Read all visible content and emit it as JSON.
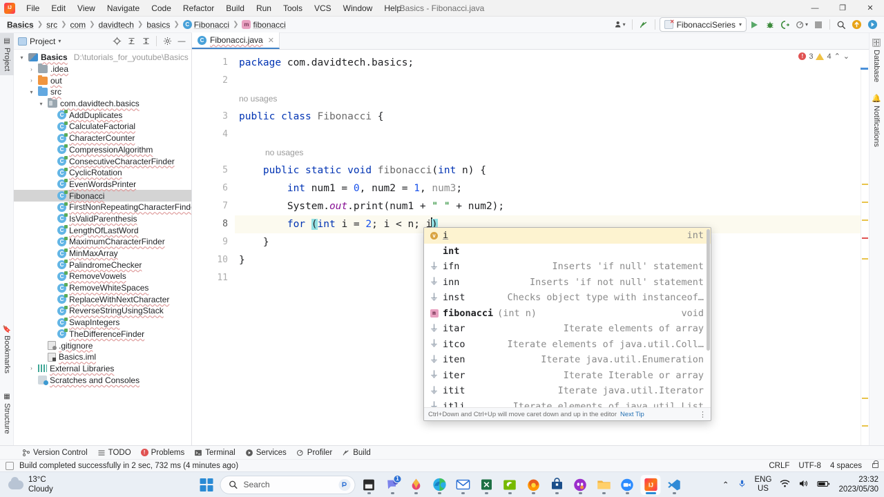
{
  "window": {
    "title": "Basics - Fibonacci.java",
    "app_icon": "intellij-idea-logo",
    "minimize": "—",
    "maximize": "❐",
    "close": "✕"
  },
  "menu": {
    "items": [
      {
        "label": "File"
      },
      {
        "label": "Edit"
      },
      {
        "label": "View"
      },
      {
        "label": "Navigate"
      },
      {
        "label": "Code"
      },
      {
        "label": "Refactor"
      },
      {
        "label": "Build"
      },
      {
        "label": "Run"
      },
      {
        "label": "Tools"
      },
      {
        "label": "VCS"
      },
      {
        "label": "Window"
      },
      {
        "label": "Help"
      }
    ]
  },
  "breadcrumbs": {
    "items": [
      {
        "label": "Basics",
        "icon": "none",
        "bold": true
      },
      {
        "label": "src",
        "icon": "none",
        "bold": false
      },
      {
        "label": "com",
        "icon": "none",
        "bold": false
      },
      {
        "label": "davidtech",
        "icon": "none",
        "bold": false
      },
      {
        "label": "basics",
        "icon": "none",
        "bold": false
      },
      {
        "label": "Fibonacci",
        "icon": "java-class-icon",
        "bold": false
      },
      {
        "label": "fibonacci",
        "icon": "java-method-icon",
        "bold": false
      }
    ]
  },
  "toolbar": {
    "user_icon": "account-icon",
    "back_icon": "updates-arrow-icon",
    "run_config": "FibonacciSeries",
    "run_icon": "run-icon",
    "debug_icon": "debug-icon",
    "run_with_coverage_icon": "coverage-icon",
    "profile_icon": "profiler-icon",
    "stop_icon": "stop-icon",
    "search_icon": "search-everywhere-icon",
    "update_icon": "update-project-icon",
    "next_icon": "forward-icon"
  },
  "left_strip": {
    "tools": [
      {
        "label": "Project",
        "icon": "project-icon",
        "active": true
      },
      {
        "label": "Bookmarks",
        "icon": "bookmarks-icon",
        "active": false
      },
      {
        "label": "Structure",
        "icon": "structure-icon",
        "active": false
      }
    ]
  },
  "right_strip": {
    "tools": [
      {
        "label": "Database",
        "icon": "database-icon"
      },
      {
        "label": "Notifications",
        "icon": "notifications-icon"
      }
    ]
  },
  "project_panel": {
    "title": "Project",
    "actions": [
      "locate-icon",
      "expand-all-icon",
      "collapse-all-icon",
      "settings-gear-icon",
      "hide-icon"
    ],
    "tree": [
      {
        "label": "Basics",
        "path": "D:\\tutorials_for_youtube\\Basics",
        "icon": "project-folder-icon",
        "indent": 0,
        "arrow": "▾",
        "bold": true,
        "selected": false
      },
      {
        "label": ".idea",
        "icon": "folder-icon",
        "indent": 1,
        "arrow": "›",
        "selected": false
      },
      {
        "label": "out",
        "icon": "folder-orange-icon",
        "indent": 1,
        "arrow": "›",
        "selected": false
      },
      {
        "label": "src",
        "icon": "folder-blue-icon",
        "indent": 1,
        "arrow": "▾",
        "selected": false
      },
      {
        "label": "com.davidtech.basics",
        "icon": "package-icon",
        "indent": 2,
        "arrow": "▾",
        "selected": false
      },
      {
        "label": "AddDuplicates",
        "icon": "java-class-icon",
        "indent": 3,
        "arrow": "",
        "selected": false
      },
      {
        "label": "CalculateFactorial",
        "icon": "java-class-icon",
        "indent": 3,
        "arrow": "",
        "selected": false
      },
      {
        "label": "CharacterCounter",
        "icon": "java-class-icon",
        "indent": 3,
        "arrow": "",
        "selected": false
      },
      {
        "label": "CompressionAlgorithm",
        "icon": "java-class-icon",
        "indent": 3,
        "arrow": "",
        "selected": false
      },
      {
        "label": "ConsecutiveCharacterFinder",
        "icon": "java-class-icon",
        "indent": 3,
        "arrow": "",
        "selected": false
      },
      {
        "label": "CyclicRotation",
        "icon": "java-class-icon",
        "indent": 3,
        "arrow": "",
        "selected": false
      },
      {
        "label": "EvenWordsPrinter",
        "icon": "java-class-icon",
        "indent": 3,
        "arrow": "",
        "selected": false
      },
      {
        "label": "Fibonacci",
        "icon": "java-class-icon",
        "indent": 3,
        "arrow": "",
        "selected": true
      },
      {
        "label": "FirstNonRepeatingCharacterFinder",
        "icon": "java-class-icon",
        "indent": 3,
        "arrow": "",
        "selected": false
      },
      {
        "label": "IsValidParenthesis",
        "icon": "java-class-icon",
        "indent": 3,
        "arrow": "",
        "selected": false
      },
      {
        "label": "LengthOfLastWord",
        "icon": "java-class-icon",
        "indent": 3,
        "arrow": "",
        "selected": false
      },
      {
        "label": "MaximumCharacterFinder",
        "icon": "java-class-icon",
        "indent": 3,
        "arrow": "",
        "selected": false
      },
      {
        "label": "MinMaxArray",
        "icon": "java-class-icon",
        "indent": 3,
        "arrow": "",
        "selected": false
      },
      {
        "label": "PalindromeChecker",
        "icon": "java-class-icon",
        "indent": 3,
        "arrow": "",
        "selected": false
      },
      {
        "label": "RemoveVowels",
        "icon": "java-class-icon",
        "indent": 3,
        "arrow": "",
        "selected": false
      },
      {
        "label": "RemoveWhiteSpaces",
        "icon": "java-class-icon",
        "indent": 3,
        "arrow": "",
        "selected": false
      },
      {
        "label": "ReplaceWithNextCharacter",
        "icon": "java-class-icon",
        "indent": 3,
        "arrow": "",
        "selected": false
      },
      {
        "label": "ReverseStringUsingStack",
        "icon": "java-class-icon",
        "indent": 3,
        "arrow": "",
        "selected": false
      },
      {
        "label": "SwapIntegers",
        "icon": "java-class-icon",
        "indent": 3,
        "arrow": "",
        "selected": false
      },
      {
        "label": "TheDifferenceFinder",
        "icon": "java-class-icon",
        "indent": 3,
        "arrow": "",
        "selected": false
      },
      {
        "label": ".gitignore",
        "icon": "gitignore-file-icon",
        "indent": 2,
        "arrow": "",
        "selected": false
      },
      {
        "label": "Basics.iml",
        "icon": "iml-file-icon",
        "indent": 2,
        "arrow": "",
        "selected": false
      },
      {
        "label": "External Libraries",
        "icon": "libraries-icon",
        "indent": 1,
        "arrow": "›",
        "selected": false
      },
      {
        "label": "Scratches and Consoles",
        "icon": "scratches-icon",
        "indent": 1,
        "arrow": "",
        "selected": false
      }
    ]
  },
  "editor": {
    "tab": {
      "label": "Fibonacci.java",
      "icon": "java-class-icon",
      "close": "✕"
    },
    "inspections": {
      "errors": "3",
      "warnings": "4",
      "prev": "⌃",
      "next": "⌄"
    },
    "lines": [
      {
        "num": "1",
        "text": "package com.davidtech.basics;"
      },
      {
        "num": "2",
        "text": ""
      },
      {
        "num": "",
        "text": "no usages",
        "inlay": true
      },
      {
        "num": "3",
        "text": "public class Fibonacci {"
      },
      {
        "num": "4",
        "text": ""
      },
      {
        "num": "",
        "text": "no usages",
        "inlay": true
      },
      {
        "num": "5",
        "text": "    public static void fibonacci(int n) {"
      },
      {
        "num": "6",
        "text": "        int num1 = 0, num2 = 1, num3;"
      },
      {
        "num": "7",
        "text": "        System.out.print(num1 + \" \" + num2);"
      },
      {
        "num": "8",
        "text": "        for (int i = 2; i < n; i)",
        "current": true
      },
      {
        "num": "9",
        "text": "    }"
      },
      {
        "num": "10",
        "text": "}"
      },
      {
        "num": "11",
        "text": ""
      }
    ]
  },
  "autocomplete": {
    "items": [
      {
        "icon": "variable-icon",
        "name": "i",
        "args": "",
        "desc": "",
        "type": "int",
        "selected": true
      },
      {
        "icon": "none",
        "name": "int",
        "args": "",
        "desc": "",
        "type": "",
        "selected": false
      },
      {
        "icon": "live-template-icon",
        "name": "ifn",
        "args": "",
        "desc": "Inserts 'if null' statement",
        "type": "",
        "selected": false
      },
      {
        "icon": "live-template-icon",
        "name": "inn",
        "args": "",
        "desc": "Inserts 'if not null' statement",
        "type": "",
        "selected": false
      },
      {
        "icon": "live-template-icon",
        "name": "inst",
        "args": "",
        "desc": "Checks object type with instanceof…",
        "type": "",
        "selected": false
      },
      {
        "icon": "method-icon",
        "name": "fibonacci",
        "args": "(int n)",
        "desc": "",
        "type": "void",
        "selected": false
      },
      {
        "icon": "live-template-icon",
        "name": "itar",
        "args": "",
        "desc": "Iterate elements of array",
        "type": "",
        "selected": false
      },
      {
        "icon": "live-template-icon",
        "name": "itco",
        "args": "",
        "desc": "Iterate elements of java.util.Coll…",
        "type": "",
        "selected": false
      },
      {
        "icon": "live-template-icon",
        "name": "iten",
        "args": "",
        "desc": "Iterate java.util.Enumeration",
        "type": "",
        "selected": false
      },
      {
        "icon": "live-template-icon",
        "name": "iter",
        "args": "",
        "desc": "Iterate Iterable or array",
        "type": "",
        "selected": false
      },
      {
        "icon": "live-template-icon",
        "name": "itit",
        "args": "",
        "desc": "Iterate java.util.Iterator",
        "type": "",
        "selected": false
      },
      {
        "icon": "live-template-icon",
        "name": "itli",
        "args": "",
        "desc": "Iterate elements of java.util.List",
        "type": "",
        "selected": false
      }
    ],
    "footer_hint": "Ctrl+Down and Ctrl+Up will move caret down and up in the editor",
    "footer_link": "Next Tip",
    "footer_menu": "⋮"
  },
  "tool_window_bar": {
    "items": [
      {
        "label": "Version Control",
        "icon": "version-control-icon"
      },
      {
        "label": "TODO",
        "icon": "todo-icon"
      },
      {
        "label": "Problems",
        "icon": "problems-icon"
      },
      {
        "label": "Terminal",
        "icon": "terminal-icon"
      },
      {
        "label": "Services",
        "icon": "services-icon"
      },
      {
        "label": "Profiler",
        "icon": "profiler-icon"
      },
      {
        "label": "Build",
        "icon": "build-icon"
      }
    ]
  },
  "status_bar": {
    "message": "Build completed successfully in 2 sec, 732 ms (4 minutes ago)",
    "line_separator": "CRLF",
    "encoding": "UTF-8",
    "indent": "4 spaces",
    "lock_icon": "read-only-lock-icon"
  },
  "taskbar": {
    "weather": {
      "temp": "13°C",
      "condition": "Cloudy",
      "icon": "cloud-icon"
    },
    "start_icon": "windows-start-icon",
    "search": {
      "placeholder": "Search",
      "icon": "search-icon",
      "copilot_icon": "copilot-icon"
    },
    "apps": [
      {
        "name": "file-manager-icon",
        "badge": "",
        "active": false
      },
      {
        "name": "teams-icon",
        "badge": "1",
        "active": false
      },
      {
        "name": "water-drop-icon",
        "badge": "",
        "active": false
      },
      {
        "name": "edge-icon",
        "badge": "",
        "active": false
      },
      {
        "name": "mail-icon",
        "badge": "",
        "active": false
      },
      {
        "name": "excel-icon",
        "badge": "",
        "active": false
      },
      {
        "name": "nvidia-icon",
        "badge": "",
        "active": false
      },
      {
        "name": "firefox-icon",
        "badge": "",
        "active": false
      },
      {
        "name": "microsoft-store-icon",
        "badge": "",
        "active": false
      },
      {
        "name": "discord-icon",
        "badge": "",
        "active": false
      },
      {
        "name": "file-explorer-icon",
        "badge": "",
        "active": false
      },
      {
        "name": "zoom-icon",
        "badge": "",
        "active": false
      },
      {
        "name": "intellij-idea-icon",
        "badge": "",
        "active": true
      },
      {
        "name": "vscode-icon",
        "badge": "",
        "active": false
      }
    ],
    "tray": {
      "chevron": "⌃",
      "mic_icon": "microphone-icon",
      "lang_line1": "ENG",
      "lang_line2": "US",
      "wifi_icon": "wifi-icon",
      "volume_icon": "volume-icon",
      "battery_icon": "battery-icon",
      "time": "23:32",
      "date": "2023/05/30"
    }
  }
}
